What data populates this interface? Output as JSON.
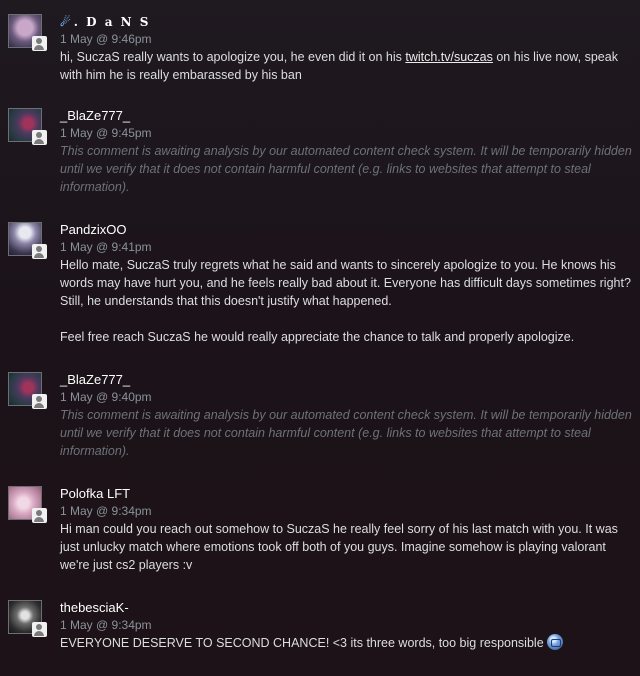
{
  "comments": [
    {
      "author": ". D a N S",
      "timestamp": "1 May @ 9:46pm",
      "text_before": "hi, SuczaS really wants to apologize you, he even did it on his ",
      "link": "twitch.tv/suczas",
      "text_after": " on his live now, speak with him he is really embarassed by his ban"
    },
    {
      "author": "_BlaZe777_",
      "timestamp": "1 May @ 9:45pm",
      "text": "This comment is awaiting analysis by our automated content check system. It will be temporarily hidden until we verify that it does not contain harmful content (e.g. links to websites that attempt to steal information)."
    },
    {
      "author": "PandzixOO",
      "timestamp": "1 May @ 9:41pm",
      "text": "Hello mate, SuczaS truly regrets what he said and wants to sincerely apologize to you. He knows his words may have hurt you, and he feels really bad about it. Everyone has difficult days sometimes right? Still, he understands that this doesn't justify what happened.",
      "text2": "Feel free reach SuczaS he would really appreciate the chance to talk and properly apologize."
    },
    {
      "author": "_BlaZe777_",
      "timestamp": "1 May @ 9:40pm",
      "text": "This comment is awaiting analysis by our automated content check system. It will be temporarily hidden until we verify that it does not contain harmful content (e.g. links to websites that attempt to steal information)."
    },
    {
      "author": "Polofka LFT",
      "timestamp": "1 May @ 9:34pm",
      "text": "Hi man could you reach out somehow to SuczaS he really feel sorry of his last match with you. It was just unlucky match where emotions took off both of you guys. Imagine somehow is playing valorant we're just cs2 players :v"
    },
    {
      "author": "thebesciaK-",
      "timestamp": "1 May @ 9:34pm",
      "text": "EVERYONE DESERVE TO SECOND CHANCE! <3 its three words, too big responsible"
    }
  ],
  "icons": {
    "status_badge": "person-icon",
    "dans_prefix": "rocket-icon",
    "emoji": "blue-face-emoji-icon"
  },
  "colors": {
    "background": "#1e161c",
    "author": "#ffffff",
    "timestamp": "#8b929a",
    "body_text": "#dcdedf",
    "hidden_text": "#6d7279"
  }
}
